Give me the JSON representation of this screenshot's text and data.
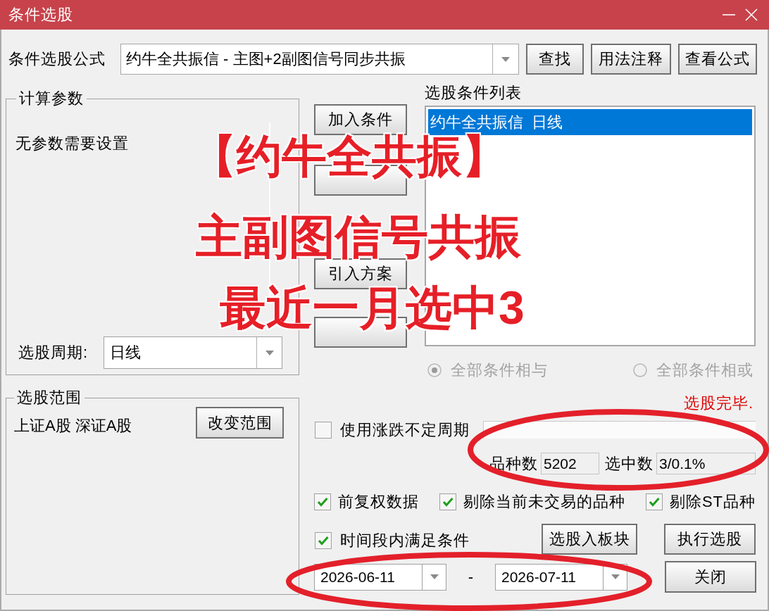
{
  "window": {
    "title": "条件选股"
  },
  "formula": {
    "label": "条件选股公式",
    "value": "约牛全共振信 - 主图+2副图信号同步共振"
  },
  "toolbar_buttons": [
    "查找",
    "用法注释",
    "查看公式"
  ],
  "parameters_group": {
    "title": "计算参数",
    "message": "无参数需要设置",
    "period_label": "选股周期:",
    "period_value": "日线"
  },
  "middle_buttons": [
    {
      "kind": "labeled",
      "label": "加入条件"
    },
    {
      "kind": "covered"
    },
    {
      "kind": "labeled",
      "label": "引入方案"
    },
    {
      "kind": "covered"
    }
  ],
  "condition_list": {
    "title": "选股条件列表",
    "items": [
      {
        "label": "约牛全共振信  日线",
        "selected": true
      }
    ]
  },
  "logic_options": [
    {
      "label": "全部条件相与",
      "selected": true,
      "disabled": true
    },
    {
      "label": "全部条件相或",
      "selected": false,
      "disabled": true
    }
  ],
  "range_group": {
    "title": "选股范围",
    "markets": "上证A股 深证A股",
    "button": "改变范围"
  },
  "status": "选股完毕.",
  "variable_period": {
    "label": "使用涨跌不定周期",
    "checked": false
  },
  "stats": [
    {
      "label": "品种数",
      "value": "5202"
    },
    {
      "label": "选中数",
      "value": "3/0.1%"
    }
  ],
  "options": [
    {
      "label": "前复权数据",
      "checked": true
    },
    {
      "label": "剔除当前未交易的品种",
      "checked": true
    },
    {
      "label": "剔除ST品种",
      "checked": true
    }
  ],
  "time_range": {
    "label": "时间段内满足条件",
    "checked": true,
    "start": "2026-06-11",
    "separator": "-",
    "end": "2026-07-11"
  },
  "action_buttons": [
    "选股入板块",
    "执行选股",
    "关闭"
  ],
  "annotation": {
    "caption_lines": [
      "【约牛全共振】",
      "主副图信号共振",
      "最近一月选中3"
    ]
  }
}
